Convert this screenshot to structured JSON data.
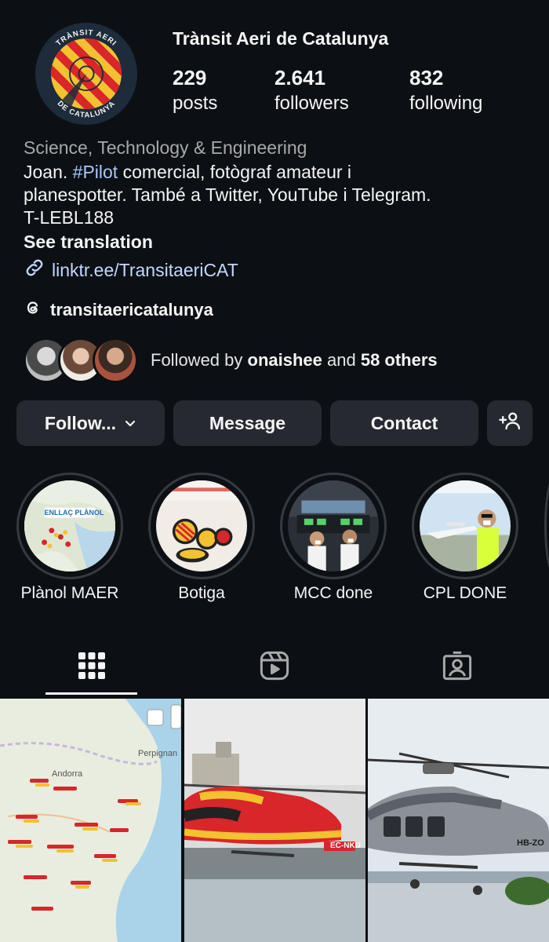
{
  "profile": {
    "name": "Trànsit Aeri de Catalunya",
    "avatar_text_top": "TRÀNSIT AERI",
    "avatar_text_bottom": "DE CATALUNYA",
    "stats": [
      {
        "value": "229",
        "label": "posts"
      },
      {
        "value": "2.641",
        "label": "followers"
      },
      {
        "value": "832",
        "label": "following"
      }
    ],
    "category": "Science, Technology & Engineering",
    "bio_line1_pre": "Joan. ",
    "bio_hashtag": "#Pilot",
    "bio_line1_post": " comercial, fotògraf amateur i",
    "bio_line2": "planespotter. També a Twitter, YouTube i Telegram.",
    "bio_line3": "T-LEBL188",
    "see_translation": "See translation",
    "link": "linktr.ee/TransitaeriCAT",
    "threads_handle": "transitaericatalunya"
  },
  "followed_by": {
    "prefix": "Followed by ",
    "user": "onaishee",
    "middle": " and ",
    "others": "58 others"
  },
  "actions": {
    "follow": "Follow...",
    "message": "Message",
    "contact": "Contact"
  },
  "highlights": [
    {
      "label": "Plànol MAER",
      "inner_text": "ENLLAÇ PLÀNOL"
    },
    {
      "label": "Botiga"
    },
    {
      "label": "MCC done"
    },
    {
      "label": "CPL DONE"
    }
  ],
  "grid": {
    "map_labels": [
      "Andorra",
      "Perpignan"
    ],
    "heli1_reg": "EC-NKU",
    "heli2_reg": "HB-ZO"
  },
  "colors": {
    "background": "#0c1014",
    "button": "#262a30",
    "link": "#c4d7ff",
    "muted": "#a8a8a8"
  },
  "icons": {
    "follow_chevron": "chevron-down-icon",
    "add_person": "add-person-icon",
    "link": "link-icon",
    "threads": "threads-icon",
    "grid_tab": "grid-icon",
    "reels_tab": "reels-icon",
    "tagged_tab": "tagged-icon"
  }
}
